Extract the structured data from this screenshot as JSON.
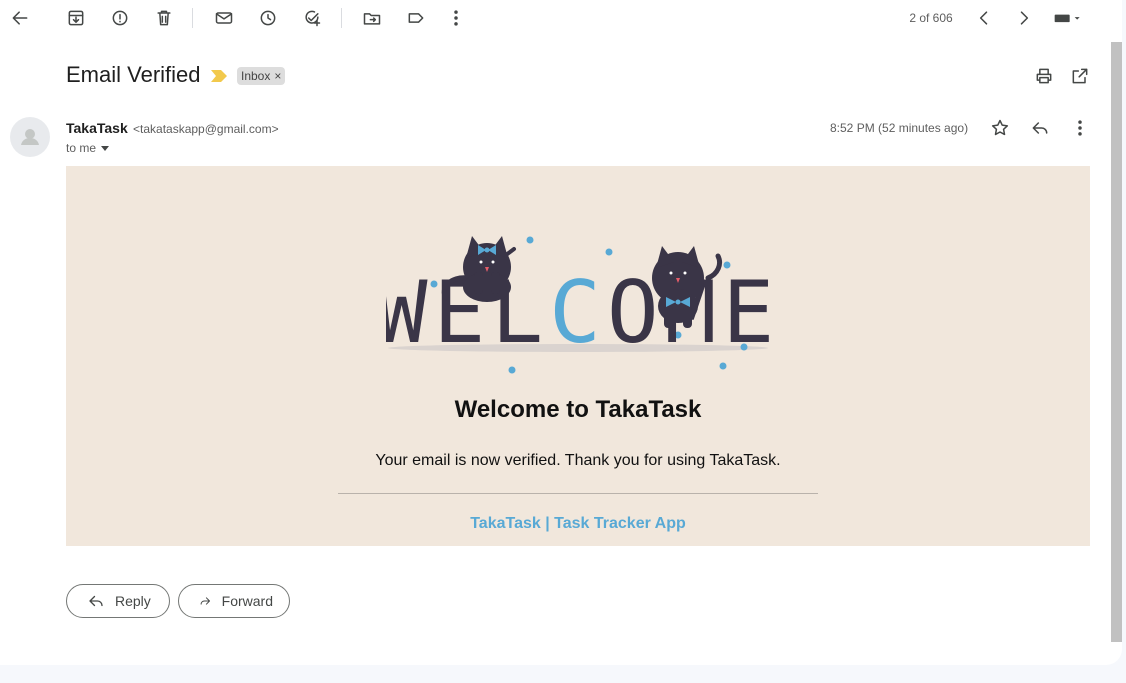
{
  "toolbar": {
    "pager_text": "2 of 606"
  },
  "message": {
    "subject": "Email Verified",
    "label": "Inbox",
    "sender_name": "TakaTask",
    "sender_email": "<takataskapp@gmail.com>",
    "recipient": "to me",
    "timestamp": "8:52 PM (52 minutes ago)"
  },
  "email_content": {
    "banner_word": "WELCOME",
    "heading": "Welcome to TakaTask",
    "body": "Your email is now verified. Thank you for using TakaTask.",
    "footer": "TakaTask | Task Tracker App"
  },
  "actions": {
    "reply_label": "Reply",
    "forward_label": "Forward"
  },
  "colors": {
    "banner_bg": "#f1e7dc",
    "accent_blue": "#58a9d5",
    "cat_dark": "#3a3547",
    "label_chip": "#dddddd",
    "importance_marker": "#f2c94c"
  }
}
